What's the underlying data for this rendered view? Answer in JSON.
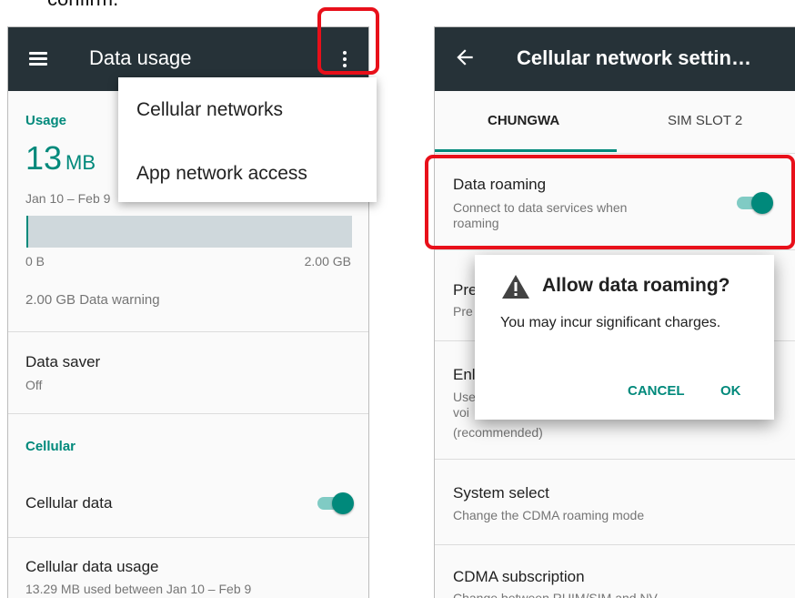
{
  "caption": "confirm.",
  "left": {
    "appbar": {
      "title": "Data usage"
    },
    "usage": {
      "header": "Usage",
      "amount": "13",
      "unit": "MB",
      "range": "Jan 10 – Feb 9",
      "bar_fill_fraction": 0.0065,
      "bar_min": "0 B",
      "bar_max": "2.00 GB",
      "warning": "2.00 GB Data warning"
    },
    "data_saver": {
      "title": "Data saver",
      "summary": "Off"
    },
    "cellular_header": "Cellular",
    "cellular_data": {
      "title": "Cellular data",
      "enabled": true
    },
    "cellular_data_usage": {
      "title": "Cellular data usage",
      "summary": "13.29 MB used between Jan 10 – Feb 9"
    },
    "menu": {
      "items": [
        "Cellular networks",
        "App network access"
      ]
    }
  },
  "right": {
    "appbar": {
      "title": "Cellular network settin…"
    },
    "tabs": [
      "CHUNGWA",
      "SIM SLOT 2"
    ],
    "selected_tab": "CHUNGWA",
    "data_roaming": {
      "title": "Data roaming",
      "summary": "Connect to data services when roaming",
      "enabled": true
    },
    "preferred_network": {
      "title_fragment": "Pre",
      "summary_fragment": "Pre"
    },
    "enhanced": {
      "title_fragment": "Enl",
      "summary_fragment_1": "Use",
      "summary_fragment_2": "voi",
      "summary_tail": "(recommended)"
    },
    "system_select": {
      "title": "System select",
      "summary": "Change the CDMA roaming mode"
    },
    "cdma_subscription": {
      "title": "CDMA subscription",
      "summary": "Change between RUIM/SIM and NV"
    },
    "dialog": {
      "title": "Allow data roaming?",
      "message": "You may incur significant charges.",
      "cancel": "CANCEL",
      "ok": "OK"
    }
  },
  "colors": {
    "appbar": "#263238",
    "accent": "#00897b",
    "highlight": "#e8101a",
    "track": "#cfd8dc"
  }
}
